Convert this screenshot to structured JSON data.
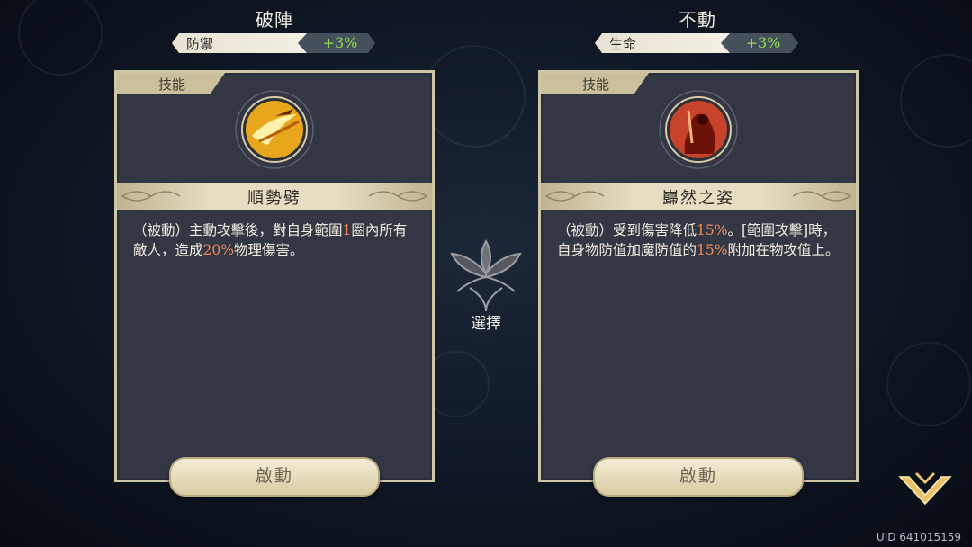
{
  "left": {
    "title": "破陣",
    "stat_name": "防禦",
    "stat_value": "+3%",
    "tab": "技能",
    "skill_name": "順勢劈",
    "desc_parts": [
      "（被動）主動攻擊後，對自身範圍",
      "1",
      "圈內所有敵人，造成",
      "20%",
      "物理傷害。"
    ],
    "button": "啟動",
    "icon": "golden-slash-icon"
  },
  "right": {
    "title": "不動",
    "stat_name": "生命",
    "stat_value": "+3%",
    "tab": "技能",
    "skill_name": "巋然之姿",
    "desc_parts": [
      "（被動）受到傷害降低",
      "15%",
      "。[範圍攻擊]時，自身物防值加魔防值的",
      "15%",
      "附加在物攻值上。"
    ],
    "button": "啟動",
    "icon": "red-warrior-icon"
  },
  "center": {
    "label": "選擇",
    "icon": "lotus-emblem-icon"
  },
  "uid": "UID 641015159",
  "colors": {
    "highlight": "#f08a5a",
    "stat_green": "#8fe14d",
    "card_bg": "#333744",
    "frame": "#cfc6a6"
  }
}
